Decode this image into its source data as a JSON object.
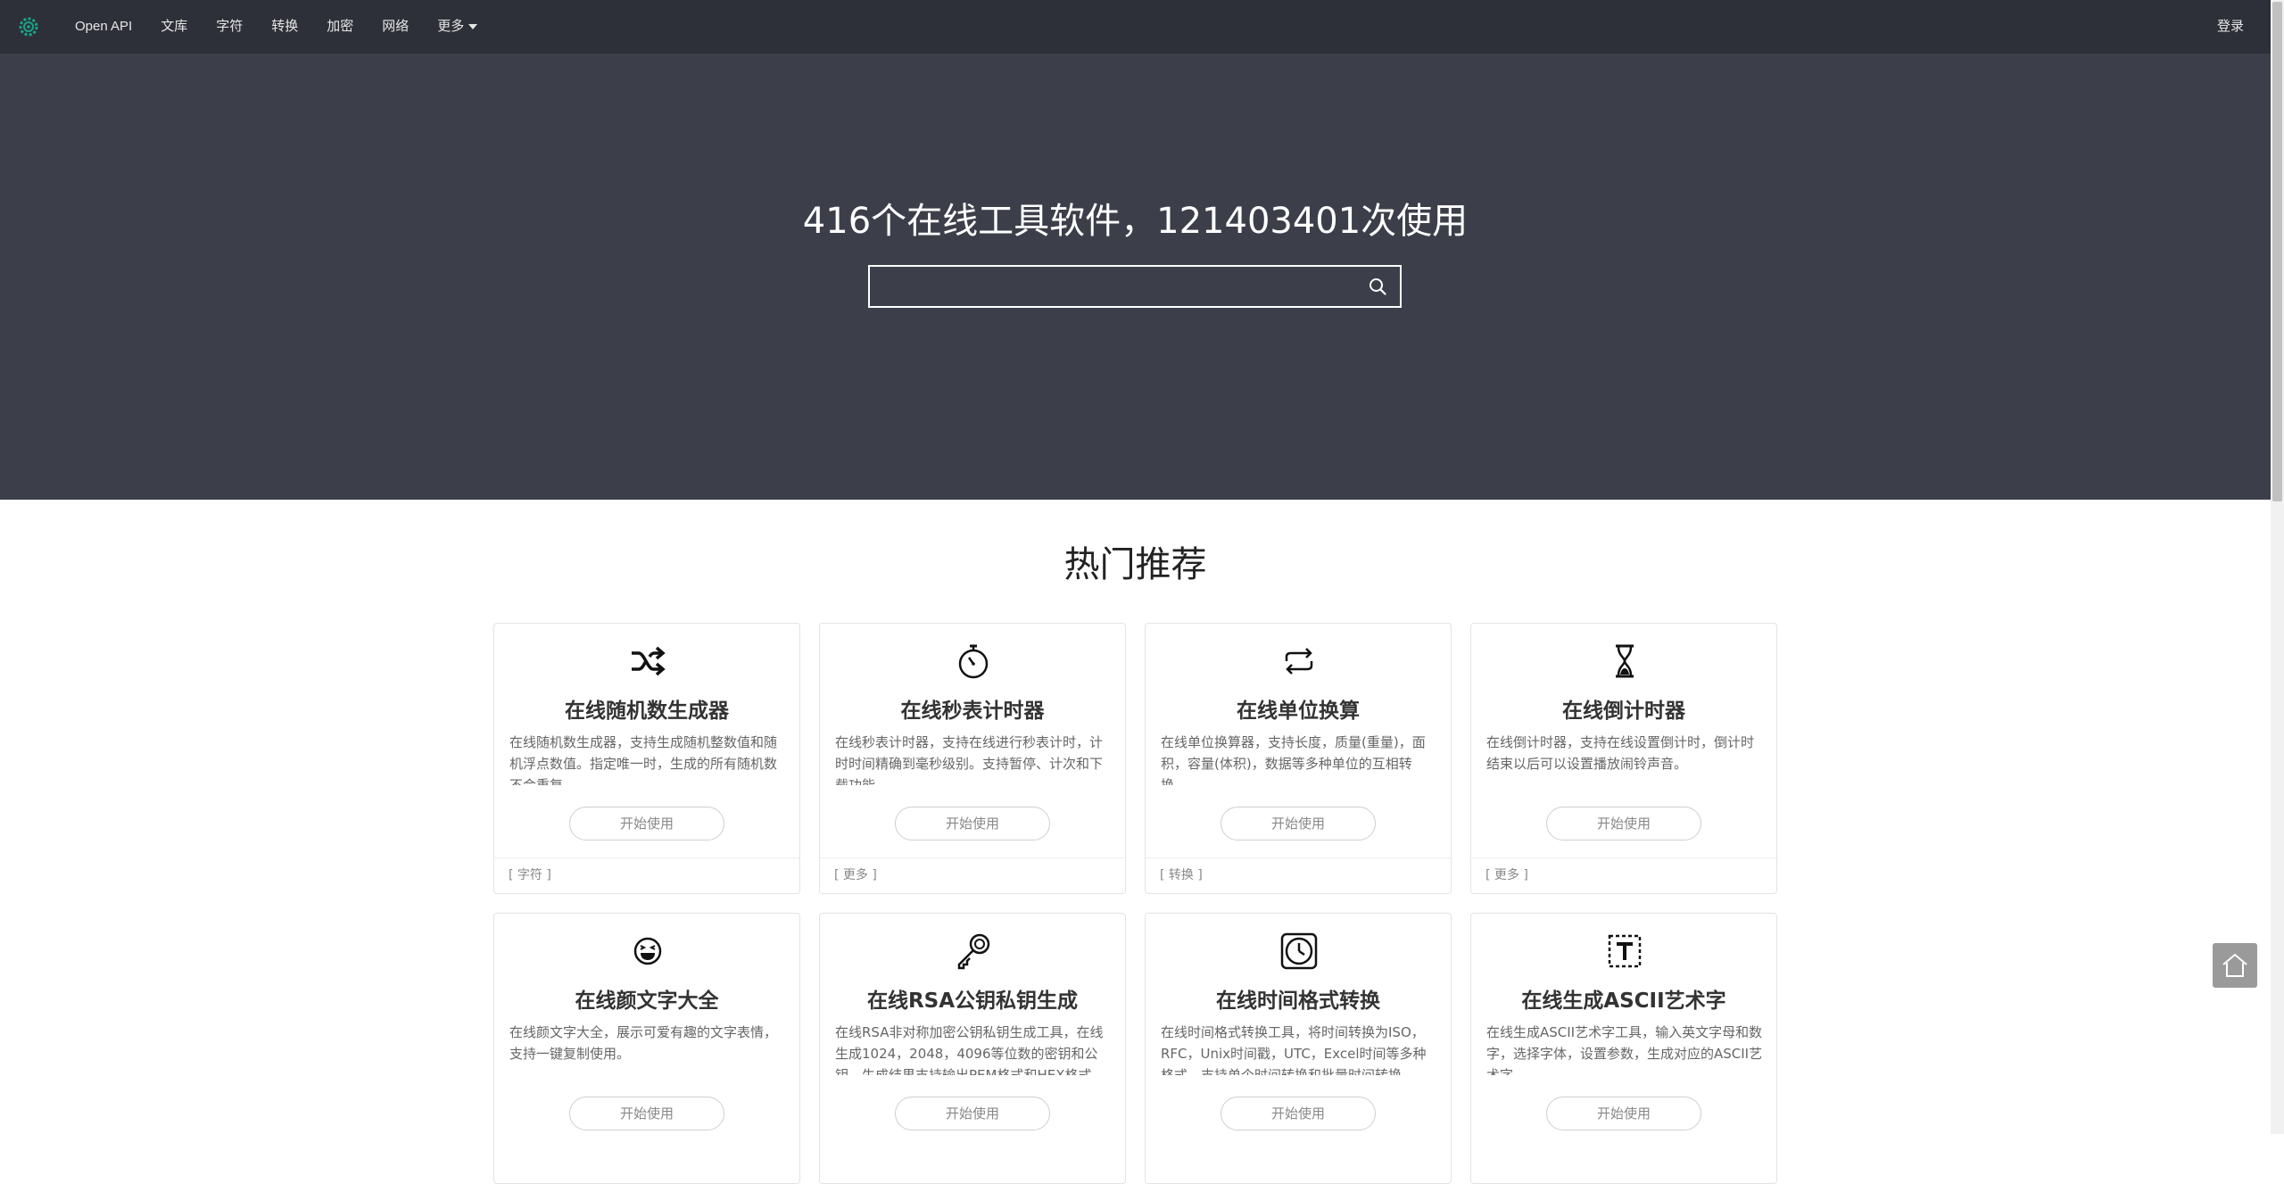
{
  "nav": {
    "items": [
      {
        "label": "Open API"
      },
      {
        "label": "文库"
      },
      {
        "label": "字符"
      },
      {
        "label": "转换"
      },
      {
        "label": "加密"
      },
      {
        "label": "网络"
      },
      {
        "label": "更多"
      }
    ],
    "login": "登录"
  },
  "hero": {
    "title": "416个在线工具软件，121403401次使用",
    "search_value": ""
  },
  "section": {
    "title": "热门推荐"
  },
  "cards": [
    {
      "icon": "shuffle-icon",
      "title": "在线随机数生成器",
      "desc": "在线随机数生成器，支持生成随机整数值和随机浮点数值。指定唯一时，生成的所有随机数不会重复。",
      "button": "开始使用",
      "tag": "[ 字符 ]"
    },
    {
      "icon": "stopwatch-icon",
      "title": "在线秒表计时器",
      "desc": "在线秒表计时器，支持在线进行秒表计时，计时时间精确到毫秒级别。支持暂停、计次和下载功能。",
      "button": "开始使用",
      "tag": "[ 更多 ]"
    },
    {
      "icon": "repeat-icon",
      "title": "在线单位换算",
      "desc": "在线单位换算器，支持长度，质量(重量)，面积，容量(体积)，数据等多种单位的互相转换。",
      "button": "开始使用",
      "tag": "[ 转换 ]"
    },
    {
      "icon": "hourglass-icon",
      "title": "在线倒计时器",
      "desc": "在线倒计时器，支持在线设置倒计时，倒计时结束以后可以设置播放闹铃声音。",
      "button": "开始使用",
      "tag": "[ 更多 ]"
    },
    {
      "icon": "laughing-face-icon",
      "title": "在线颜文字大全",
      "desc": "在线颜文字大全，展示可爱有趣的文字表情，支持一键复制使用。",
      "button": "开始使用",
      "tag": ""
    },
    {
      "icon": "key-icon",
      "title": "在线RSA公钥私钥生成",
      "desc": "在线RSA非对称加密公钥私钥生成工具，在线生成1024，2048，4096等位数的密钥和公钥，生成结果支持输出PEM格式和HEX格式。",
      "button": "开始使用",
      "tag": ""
    },
    {
      "icon": "clock-icon",
      "title": "在线时间格式转换",
      "desc": "在线时间格式转换工具，将时间转换为ISO，RFC，Unix时间戳，UTC，Excel时间等多种格式，支持单个时间转换和批量时间转换。",
      "button": "开始使用",
      "tag": ""
    },
    {
      "icon": "text-box-icon",
      "title": "在线生成ASCII艺术字",
      "desc": "在线生成ASCII艺术字工具，输入英文字母和数字，选择字体，设置参数，生成对应的ASCII艺术字。",
      "button": "开始使用",
      "tag": ""
    }
  ]
}
